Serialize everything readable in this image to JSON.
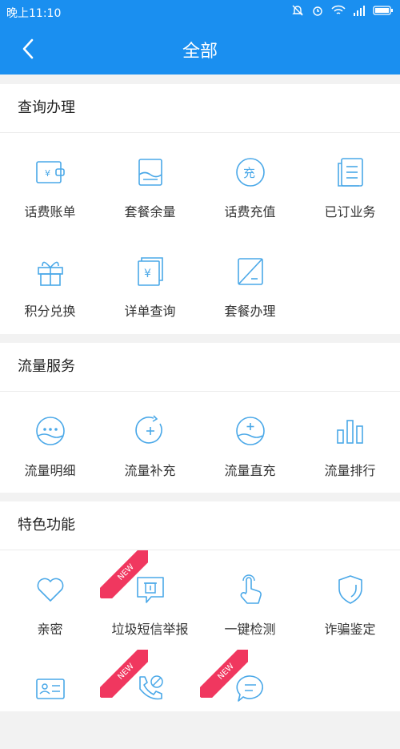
{
  "status": {
    "time": "晚上11:10"
  },
  "header": {
    "title": "全部"
  },
  "sections": [
    {
      "title": "查询办理",
      "items": [
        {
          "label": "话费账单",
          "icon": "wallet-yen-icon"
        },
        {
          "label": "套餐余量",
          "icon": "package-balance-icon"
        },
        {
          "label": "话费充值",
          "icon": "recharge-icon"
        },
        {
          "label": "已订业务",
          "icon": "document-list-icon"
        },
        {
          "label": "积分兑换",
          "icon": "gift-icon"
        },
        {
          "label": "详单查询",
          "icon": "bill-detail-icon"
        },
        {
          "label": "套餐办理",
          "icon": "package-apply-icon"
        }
      ]
    },
    {
      "title": "流量服务",
      "items": [
        {
          "label": "流量明细",
          "icon": "data-detail-icon"
        },
        {
          "label": "流量补充",
          "icon": "data-topup-icon"
        },
        {
          "label": "流量直充",
          "icon": "data-direct-icon"
        },
        {
          "label": "流量排行",
          "icon": "bar-chart-icon"
        }
      ]
    },
    {
      "title": "特色功能",
      "items": [
        {
          "label": "亲密",
          "icon": "heart-icon"
        },
        {
          "label": "垃圾短信举报",
          "icon": "spam-report-icon",
          "badge": "NEW"
        },
        {
          "label": "一键检测",
          "icon": "touch-icon"
        },
        {
          "label": "诈骗鉴定",
          "icon": "shield-icon"
        },
        {
          "label": "",
          "icon": "id-card-icon"
        },
        {
          "label": "",
          "icon": "phone-block-icon",
          "badge": "NEW"
        },
        {
          "label": "",
          "icon": "message-icon",
          "badge": "NEW"
        }
      ]
    }
  ],
  "colors": {
    "primary": "#1a8ff0",
    "icon": "#4aa8e8",
    "badge": "#f0375f"
  }
}
